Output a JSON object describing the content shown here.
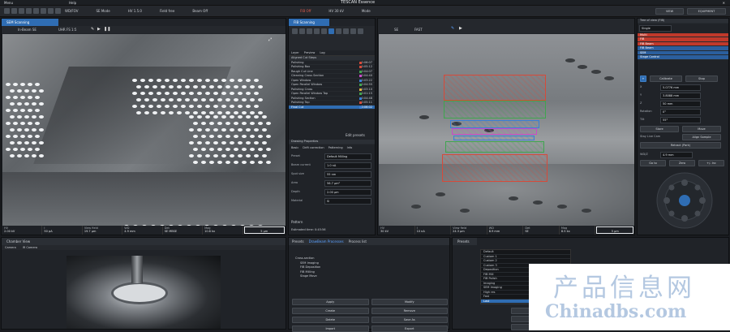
{
  "app": {
    "title": "TESCAN Essence",
    "menu": "Menu",
    "help": "Help"
  },
  "toolbar": {
    "items": [
      "WD/FOV",
      "SE Mode",
      "HV 1.5.0",
      "Field free",
      "Beam Off",
      "FIB Off",
      "HV 30 kV",
      "Mode"
    ],
    "right_view": "VIEW",
    "right_equipment": "EQUIPMENT"
  },
  "sem_view": {
    "tab": "SEM Scanning",
    "mode": "In-Beam SE",
    "speed": "UHR FS 1:5",
    "scale": "5 µm",
    "status": [
      {
        "label": "HV",
        "value": "2.00 kV"
      },
      {
        "label": "I",
        "value": "50 pA"
      },
      {
        "label": "View field",
        "value": "19.7 µm"
      },
      {
        "label": "WD",
        "value": "4.9 mm"
      },
      {
        "label": "Det",
        "value": "SE MBSE"
      },
      {
        "label": "Mag",
        "value": "10.6 kx"
      },
      {
        "label": "Date",
        "value": "2017"
      }
    ]
  },
  "fib_view": {
    "tab": "FIB Scanning",
    "mode": "SE",
    "speed": "FAST",
    "scale": "5 µm",
    "status": [
      {
        "label": "HV",
        "value": "30 kV"
      },
      {
        "label": "I",
        "value": "10 nA"
      },
      {
        "label": "View field",
        "value": "24.3 µm"
      },
      {
        "label": "WD",
        "value": "8.9 mm"
      },
      {
        "label": "Det",
        "value": "SE"
      },
      {
        "label": "Mag",
        "value": "8.5 kx"
      }
    ]
  },
  "drawbeam": {
    "tabs": [
      "Layer",
      "Preview",
      "Log"
    ],
    "section": "Aligned Cut Steps",
    "items": [
      {
        "name": "Polishing",
        "time": "0:06:07",
        "color": "#d64a3a"
      },
      {
        "name": "Polishing Box",
        "time": "0:05:12",
        "color": "#d64a3a"
      },
      {
        "name": "Rough Cut Line",
        "time": "0:04:07",
        "color": "#3fa54f"
      },
      {
        "name": "Cleaning Cross Section",
        "time": "0:04:40",
        "color": "#c94ac9"
      },
      {
        "name": "Open Window",
        "time": "0:03:22",
        "color": "#3a7fd6"
      },
      {
        "name": "Open Parallel Window",
        "time": "0:04:55",
        "color": "#3fa54f"
      },
      {
        "name": "Polishing Cross",
        "time": "0:03:10",
        "color": "#e0b040"
      },
      {
        "name": "Open Parallel Window Top",
        "time": "0:01:15",
        "color": "#3fa54f"
      },
      {
        "name": "Polishing Section",
        "time": "0:04:48",
        "color": "#3a7fd6"
      },
      {
        "name": "Polishing Top",
        "time": "0:05:11",
        "color": "#d64a3a"
      },
      {
        "name": "Final Cut",
        "time": "0:06:02",
        "color": "#3a7fd6"
      }
    ],
    "edit_label": "Edit presets",
    "settings_title": "Drawing Properties",
    "settings_tabs": [
      "Basic",
      "Drift correction",
      "Patterning",
      "Info"
    ],
    "fields": [
      {
        "label": "Preset",
        "value": "Default Milling"
      },
      {
        "label": "Beam current",
        "value": "1.0 nA"
      },
      {
        "label": "Spot size",
        "value": "55 nm"
      },
      {
        "label": "Area",
        "value": "56.7 µm²"
      },
      {
        "label": "Depth",
        "value": "2.00 µm"
      },
      {
        "label": "Material",
        "value": "Si"
      }
    ],
    "tab_current": "Pattern",
    "estimate": "Estimated time: 0:45:56"
  },
  "right_panel": {
    "title": "Tree of view (FIB)",
    "combo": "Single",
    "layers": [
      {
        "name": "Multi",
        "color": "#c0392b"
      },
      {
        "name": "FIB",
        "color": "#c0392b"
      },
      {
        "name": "FIB Beam",
        "color": "#c0392b"
      },
      {
        "name": "FIB Beam",
        "color": "#2b5f9e"
      },
      {
        "name": "SEM",
        "color": "#2b5f9e"
      },
      {
        "name": "Stage Control",
        "color": "#2b5f9e"
      }
    ],
    "controls": {
      "calibrate": "Calibrate",
      "stop": "Stop",
      "x_label": "X",
      "x_value": "5.0776 mm",
      "y_label": "Y",
      "y_value": "3.8088 mm",
      "z_label": "Z",
      "z_value": "50 mm",
      "r_label": "Rotation",
      "r_value": "0°",
      "t_label": "Tilt",
      "t_value": "55°",
      "store": "Store",
      "move": "Move",
      "checkbox": "Stay Live Cam",
      "go_sample": "Align Sample",
      "park": "Retract (Park)",
      "wd_label": "WD/Z",
      "wd_value": "4.9 mm",
      "go": "Go to",
      "zero": "Zero",
      "plus": "+/- Inc"
    }
  },
  "bottom": {
    "chamber_tab": "Chamber View",
    "chamber_views": [
      "Camera",
      "IR Camera"
    ],
    "process_tabs": [
      "Presets",
      "DrawBeam Processes",
      "Process list"
    ],
    "tree": [
      "Cross-section",
      "SEM Imaging",
      "FIB Deposition",
      "FIB Milling",
      "Stage Move"
    ],
    "presets_header": "Presets",
    "presets": [
      "Default",
      "Custom 1",
      "Custom 2",
      "Custom 3",
      "Deposition",
      "FIB Mill",
      "FIB Polish",
      "Imaging",
      "SEM Imaging",
      "High res",
      "Fast",
      "Last"
    ],
    "buttons": [
      "Apply",
      "Modify",
      "Create",
      "Remove",
      "Delete",
      "Save As",
      "Import",
      "Export"
    ],
    "right_buttons": [
      "Apply",
      "Delete",
      "Import"
    ]
  },
  "watermark": {
    "cn": "产品信息网",
    "en": "Chinadbs.com"
  },
  "colors": {
    "accent": "#2f6db3",
    "bg": "#1a1c20"
  }
}
